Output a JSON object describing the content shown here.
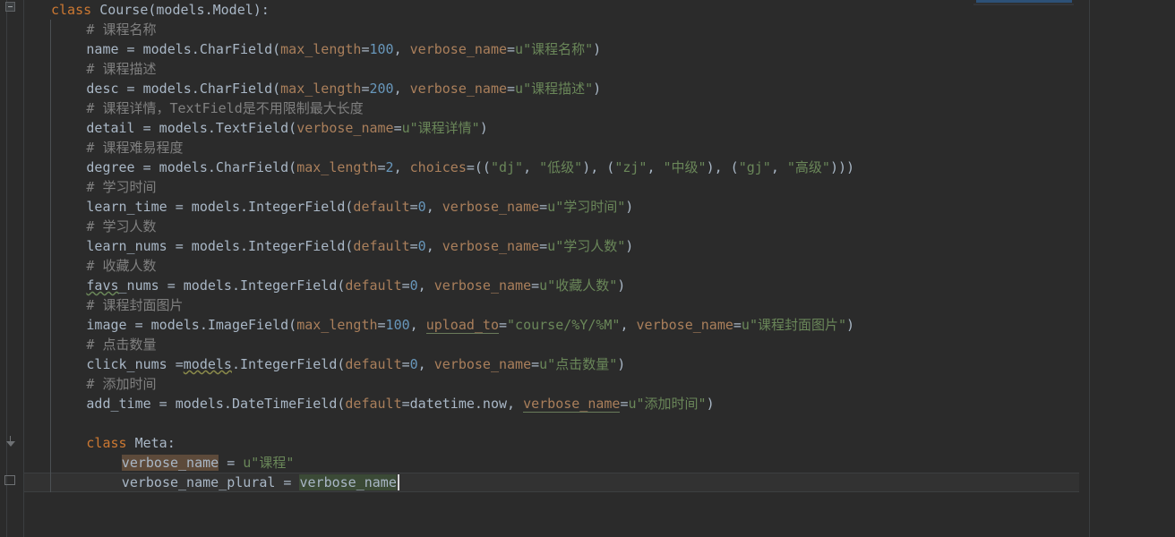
{
  "editor": {
    "theme": "darcula",
    "background": "#2b2b2b",
    "gutter_background": "#2b2b2b",
    "font_size_px": 15,
    "line_height_px": 22,
    "caret_line_index": 24,
    "right_margin_column_x": 1216,
    "colors": {
      "keyword": "#cc7832",
      "comment": "#808080",
      "string": "#6a8759",
      "number": "#6897bb",
      "kwarg": "#aa7f5b",
      "identifier": "#a9b7c6",
      "caret": "#d6d6d6",
      "current_line": "#323232",
      "write_highlight": "#5d4a3a",
      "read_highlight": "#3b4a36",
      "scroll_marker": "#2d5177"
    }
  },
  "gutter": {
    "fold_markers": [
      {
        "type": "collapse-box",
        "line": 0
      },
      {
        "type": "fold-arrow-down",
        "line": 22
      },
      {
        "type": "fold-arrow-up",
        "line": 24
      }
    ]
  },
  "code": {
    "language": "python",
    "lines": [
      {
        "n": 0,
        "indent": 0,
        "tokens": [
          {
            "t": "class",
            "c": "kw"
          },
          {
            "t": " ",
            "c": "punct"
          },
          {
            "t": "Course",
            "c": "cls"
          },
          {
            "t": "(",
            "c": "punct"
          },
          {
            "t": "models.Model",
            "c": "ident"
          },
          {
            "t": "):",
            "c": "punct"
          }
        ]
      },
      {
        "n": 1,
        "indent": 1,
        "tokens": [
          {
            "t": "# 课程名称",
            "c": "comment"
          }
        ]
      },
      {
        "n": 2,
        "indent": 1,
        "tokens": [
          {
            "t": "name",
            "c": "ident"
          },
          {
            "t": " = ",
            "c": "punct"
          },
          {
            "t": "models.CharField",
            "c": "ident"
          },
          {
            "t": "(",
            "c": "punct"
          },
          {
            "t": "max_length",
            "c": "kwarg"
          },
          {
            "t": "=",
            "c": "punct"
          },
          {
            "t": "100",
            "c": "num"
          },
          {
            "t": ", ",
            "c": "punct"
          },
          {
            "t": "verbose_name",
            "c": "kwarg"
          },
          {
            "t": "=",
            "c": "punct"
          },
          {
            "t": "u\"课程名称\"",
            "c": "str"
          },
          {
            "t": ")",
            "c": "punct"
          }
        ]
      },
      {
        "n": 3,
        "indent": 1,
        "tokens": [
          {
            "t": "# 课程描述",
            "c": "comment"
          }
        ]
      },
      {
        "n": 4,
        "indent": 1,
        "tokens": [
          {
            "t": "desc",
            "c": "ident"
          },
          {
            "t": " = ",
            "c": "punct"
          },
          {
            "t": "models.CharField",
            "c": "ident"
          },
          {
            "t": "(",
            "c": "punct"
          },
          {
            "t": "max_length",
            "c": "kwarg"
          },
          {
            "t": "=",
            "c": "punct"
          },
          {
            "t": "200",
            "c": "num"
          },
          {
            "t": ", ",
            "c": "punct"
          },
          {
            "t": "verbose_name",
            "c": "kwarg"
          },
          {
            "t": "=",
            "c": "punct"
          },
          {
            "t": "u\"课程描述\"",
            "c": "str"
          },
          {
            "t": ")",
            "c": "punct"
          }
        ]
      },
      {
        "n": 5,
        "indent": 1,
        "tokens": [
          {
            "t": "# 课程详情，TextField是不用限制最大长度",
            "c": "comment"
          }
        ]
      },
      {
        "n": 6,
        "indent": 1,
        "tokens": [
          {
            "t": "detail",
            "c": "ident"
          },
          {
            "t": " = ",
            "c": "punct"
          },
          {
            "t": "models.TextField",
            "c": "ident"
          },
          {
            "t": "(",
            "c": "punct"
          },
          {
            "t": "verbose_name",
            "c": "kwarg"
          },
          {
            "t": "=",
            "c": "punct"
          },
          {
            "t": "u\"课程详情\"",
            "c": "str"
          },
          {
            "t": ")",
            "c": "punct"
          }
        ]
      },
      {
        "n": 7,
        "indent": 1,
        "tokens": [
          {
            "t": "# 课程难易程度",
            "c": "comment"
          }
        ]
      },
      {
        "n": 8,
        "indent": 1,
        "tokens": [
          {
            "t": "degree",
            "c": "ident"
          },
          {
            "t": " = ",
            "c": "punct"
          },
          {
            "t": "models.CharField",
            "c": "ident"
          },
          {
            "t": "(",
            "c": "punct"
          },
          {
            "t": "max_length",
            "c": "kwarg"
          },
          {
            "t": "=",
            "c": "punct"
          },
          {
            "t": "2",
            "c": "num"
          },
          {
            "t": ", ",
            "c": "punct"
          },
          {
            "t": "choices",
            "c": "kwarg"
          },
          {
            "t": "=((",
            "c": "punct"
          },
          {
            "t": "\"dj\"",
            "c": "str"
          },
          {
            "t": ", ",
            "c": "punct"
          },
          {
            "t": "\"低级\"",
            "c": "str"
          },
          {
            "t": "), (",
            "c": "punct"
          },
          {
            "t": "\"zj\"",
            "c": "str"
          },
          {
            "t": ", ",
            "c": "punct"
          },
          {
            "t": "\"中级\"",
            "c": "str"
          },
          {
            "t": "), (",
            "c": "punct"
          },
          {
            "t": "\"gj\"",
            "c": "str"
          },
          {
            "t": ", ",
            "c": "punct"
          },
          {
            "t": "\"高级\"",
            "c": "str"
          },
          {
            "t": ")))",
            "c": "punct"
          }
        ]
      },
      {
        "n": 9,
        "indent": 1,
        "tokens": [
          {
            "t": "# 学习时间",
            "c": "comment"
          }
        ]
      },
      {
        "n": 10,
        "indent": 1,
        "tokens": [
          {
            "t": "learn_time",
            "c": "ident"
          },
          {
            "t": " = ",
            "c": "punct"
          },
          {
            "t": "models.IntegerField",
            "c": "ident"
          },
          {
            "t": "(",
            "c": "punct"
          },
          {
            "t": "default",
            "c": "kwarg"
          },
          {
            "t": "=",
            "c": "punct"
          },
          {
            "t": "0",
            "c": "num"
          },
          {
            "t": ", ",
            "c": "punct"
          },
          {
            "t": "verbose_name",
            "c": "kwarg"
          },
          {
            "t": "=",
            "c": "punct"
          },
          {
            "t": "u\"学习时间\"",
            "c": "str"
          },
          {
            "t": ")",
            "c": "punct"
          }
        ]
      },
      {
        "n": 11,
        "indent": 1,
        "tokens": [
          {
            "t": "# 学习人数",
            "c": "comment"
          }
        ]
      },
      {
        "n": 12,
        "indent": 1,
        "tokens": [
          {
            "t": "learn_nums",
            "c": "ident"
          },
          {
            "t": " = ",
            "c": "punct"
          },
          {
            "t": "models.IntegerField",
            "c": "ident"
          },
          {
            "t": "(",
            "c": "punct"
          },
          {
            "t": "default",
            "c": "kwarg"
          },
          {
            "t": "=",
            "c": "punct"
          },
          {
            "t": "0",
            "c": "num"
          },
          {
            "t": ", ",
            "c": "punct"
          },
          {
            "t": "verbose_name",
            "c": "kwarg"
          },
          {
            "t": "=",
            "c": "punct"
          },
          {
            "t": "u\"学习人数\"",
            "c": "str"
          },
          {
            "t": ")",
            "c": "punct"
          }
        ]
      },
      {
        "n": 13,
        "indent": 1,
        "tokens": [
          {
            "t": "# 收藏人数",
            "c": "comment"
          }
        ]
      },
      {
        "n": 14,
        "indent": 1,
        "tokens": [
          {
            "t": "favs",
            "c": "ident",
            "mark": "squiggle"
          },
          {
            "t": "_nums",
            "c": "ident"
          },
          {
            "t": " = ",
            "c": "punct"
          },
          {
            "t": "models.IntegerField",
            "c": "ident"
          },
          {
            "t": "(",
            "c": "punct"
          },
          {
            "t": "default",
            "c": "kwarg"
          },
          {
            "t": "=",
            "c": "punct"
          },
          {
            "t": "0",
            "c": "num"
          },
          {
            "t": ", ",
            "c": "punct"
          },
          {
            "t": "verbose_name",
            "c": "kwarg"
          },
          {
            "t": "=",
            "c": "punct"
          },
          {
            "t": "u\"收藏人数\"",
            "c": "str"
          },
          {
            "t": ")",
            "c": "punct"
          }
        ]
      },
      {
        "n": 15,
        "indent": 1,
        "tokens": [
          {
            "t": "# 课程封面图片",
            "c": "comment"
          }
        ]
      },
      {
        "n": 16,
        "indent": 1,
        "tokens": [
          {
            "t": "image",
            "c": "ident"
          },
          {
            "t": " = ",
            "c": "punct"
          },
          {
            "t": "models.ImageField",
            "c": "ident"
          },
          {
            "t": "(",
            "c": "punct"
          },
          {
            "t": "max_length",
            "c": "kwarg"
          },
          {
            "t": "=",
            "c": "punct"
          },
          {
            "t": "100",
            "c": "num"
          },
          {
            "t": ", ",
            "c": "punct"
          },
          {
            "t": "upload_to",
            "c": "kwarg",
            "mark": "flatline"
          },
          {
            "t": "=",
            "c": "punct"
          },
          {
            "t": "\"course/%Y/%M\"",
            "c": "str"
          },
          {
            "t": ", ",
            "c": "punct"
          },
          {
            "t": "verbose_name",
            "c": "kwarg"
          },
          {
            "t": "=",
            "c": "punct"
          },
          {
            "t": "u\"课程封面图片\"",
            "c": "str"
          },
          {
            "t": ")",
            "c": "punct"
          }
        ]
      },
      {
        "n": 17,
        "indent": 1,
        "tokens": [
          {
            "t": "# 点击数量",
            "c": "comment"
          }
        ]
      },
      {
        "n": 18,
        "indent": 1,
        "tokens": [
          {
            "t": "click_nums",
            "c": "ident"
          },
          {
            "t": " =",
            "c": "punct"
          },
          {
            "t": "models",
            "c": "ident",
            "mark": "squiggle-warn"
          },
          {
            "t": ".IntegerField",
            "c": "ident"
          },
          {
            "t": "(",
            "c": "punct"
          },
          {
            "t": "default",
            "c": "kwarg"
          },
          {
            "t": "=",
            "c": "punct"
          },
          {
            "t": "0",
            "c": "num"
          },
          {
            "t": ", ",
            "c": "punct"
          },
          {
            "t": "verbose_name",
            "c": "kwarg"
          },
          {
            "t": "=",
            "c": "punct"
          },
          {
            "t": "u\"点击数量\"",
            "c": "str"
          },
          {
            "t": ")",
            "c": "punct"
          }
        ]
      },
      {
        "n": 19,
        "indent": 1,
        "tokens": [
          {
            "t": "# 添加时间",
            "c": "comment"
          }
        ]
      },
      {
        "n": 20,
        "indent": 1,
        "tokens": [
          {
            "t": "add_time",
            "c": "ident"
          },
          {
            "t": " = ",
            "c": "punct"
          },
          {
            "t": "models.DateTimeField",
            "c": "ident"
          },
          {
            "t": "(",
            "c": "punct"
          },
          {
            "t": "default",
            "c": "kwarg"
          },
          {
            "t": "=",
            "c": "punct"
          },
          {
            "t": "datetime.now",
            "c": "ident"
          },
          {
            "t": ", ",
            "c": "punct"
          },
          {
            "t": "verbose_name",
            "c": "kwarg",
            "mark": "flatline"
          },
          {
            "t": "=",
            "c": "punct"
          },
          {
            "t": "u\"添加时间\"",
            "c": "str"
          },
          {
            "t": ")",
            "c": "punct"
          }
        ]
      },
      {
        "n": 21,
        "indent": 0,
        "tokens": []
      },
      {
        "n": 22,
        "indent": 1,
        "tokens": [
          {
            "t": "class",
            "c": "kw"
          },
          {
            "t": " ",
            "c": "punct"
          },
          {
            "t": "Meta",
            "c": "cls"
          },
          {
            "t": ":",
            "c": "punct"
          }
        ]
      },
      {
        "n": 23,
        "indent": 2,
        "tokens": [
          {
            "t": "verbose_name",
            "c": "ident",
            "hl": "write"
          },
          {
            "t": " = ",
            "c": "punct"
          },
          {
            "t": "u\"课程\"",
            "c": "str"
          }
        ]
      },
      {
        "n": 24,
        "indent": 2,
        "tokens": [
          {
            "t": "verbose_name_plural",
            "c": "ident"
          },
          {
            "t": " = ",
            "c": "punct"
          },
          {
            "t": "verbose_name",
            "c": "ident",
            "hl": "read"
          }
        ]
      },
      {
        "n": 25,
        "indent": 0,
        "tokens": []
      },
      {
        "n": 26,
        "indent": 0,
        "tokens": []
      }
    ]
  },
  "markers": {
    "top_scroll_marker_label": "scroll-position-marker",
    "right_margin_label": "right-margin-guide",
    "caret_label": "text-caret"
  }
}
